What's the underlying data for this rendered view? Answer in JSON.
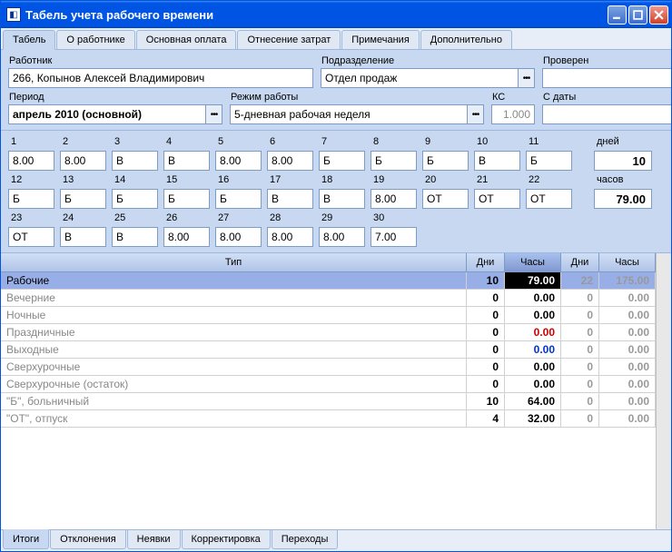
{
  "window": {
    "title": "Табель учета рабочего времени"
  },
  "tabs": {
    "top": [
      "Табель",
      "О работнике",
      "Основная оплата",
      "Отнесение затрат",
      "Примечания",
      "Дополнительно"
    ],
    "bottom": [
      "Итоги",
      "Отклонения",
      "Неявки",
      "Корректировка",
      "Переходы"
    ]
  },
  "form": {
    "employee_label": "Работник",
    "employee_value": "266, Копынов Алексей Владимирович",
    "department_label": "Подразделение",
    "department_value": "Отдел продаж",
    "verified_label": "Проверен",
    "verified_value": "",
    "period_label": "Период",
    "period_value": "апрель 2010 (основной)",
    "mode_label": "Режим работы",
    "mode_value": "5-дневная рабочая неделя",
    "kc_label": "КС",
    "kc_value": "1.000",
    "from_date_label": "С даты",
    "from_date_value": ""
  },
  "calendar": {
    "days": [
      "1",
      "2",
      "3",
      "4",
      "5",
      "6",
      "7",
      "8",
      "9",
      "10",
      "11",
      "12",
      "13",
      "14",
      "15",
      "16",
      "17",
      "18",
      "19",
      "20",
      "21",
      "22",
      "23",
      "24",
      "25",
      "26",
      "27",
      "28",
      "29",
      "30"
    ],
    "values": [
      "8.00",
      "8.00",
      "В",
      "В",
      "8.00",
      "8.00",
      "Б",
      "Б",
      "Б",
      "В",
      "Б",
      "Б",
      "Б",
      "Б",
      "Б",
      "Б",
      "В",
      "В",
      "8.00",
      "ОТ",
      "ОТ",
      "ОТ",
      "ОТ",
      "В",
      "В",
      "8.00",
      "8.00",
      "8.00",
      "8.00",
      "7.00"
    ]
  },
  "totals": {
    "days_label": "дней",
    "days_value": "10",
    "hours_label": "часов",
    "hours_value": "79.00"
  },
  "summary": {
    "headers": {
      "type": "Тип",
      "days1": "Дни",
      "hours1": "Часы",
      "days2": "Дни",
      "hours2": "Часы"
    },
    "rows": [
      {
        "type": "Рабочие",
        "d1": "10",
        "h1": "79.00",
        "d2": "22",
        "h2": "175.00",
        "hl": true
      },
      {
        "type": "Вечерние",
        "d1": "0",
        "h1": "0.00",
        "d2": "0",
        "h2": "0.00"
      },
      {
        "type": "Ночные",
        "d1": "0",
        "h1": "0.00",
        "d2": "0",
        "h2": "0.00"
      },
      {
        "type": "Праздничные",
        "d1": "0",
        "h1": "0.00",
        "d2": "0",
        "h2": "0.00",
        "h1color": "red"
      },
      {
        "type": "Выходные",
        "d1": "0",
        "h1": "0.00",
        "d2": "0",
        "h2": "0.00",
        "h1color": "blue"
      },
      {
        "type": "Сверхурочные",
        "d1": "0",
        "h1": "0.00",
        "d2": "0",
        "h2": "0.00"
      },
      {
        "type": "Сверхурочные (остаток)",
        "d1": "0",
        "h1": "0.00",
        "d2": "0",
        "h2": "0.00"
      },
      {
        "type": "\"Б\", больничный",
        "d1": "10",
        "h1": "64.00",
        "d2": "0",
        "h2": "0.00"
      },
      {
        "type": "\"ОТ\", отпуск",
        "d1": "4",
        "h1": "32.00",
        "d2": "0",
        "h2": "0.00"
      }
    ]
  }
}
